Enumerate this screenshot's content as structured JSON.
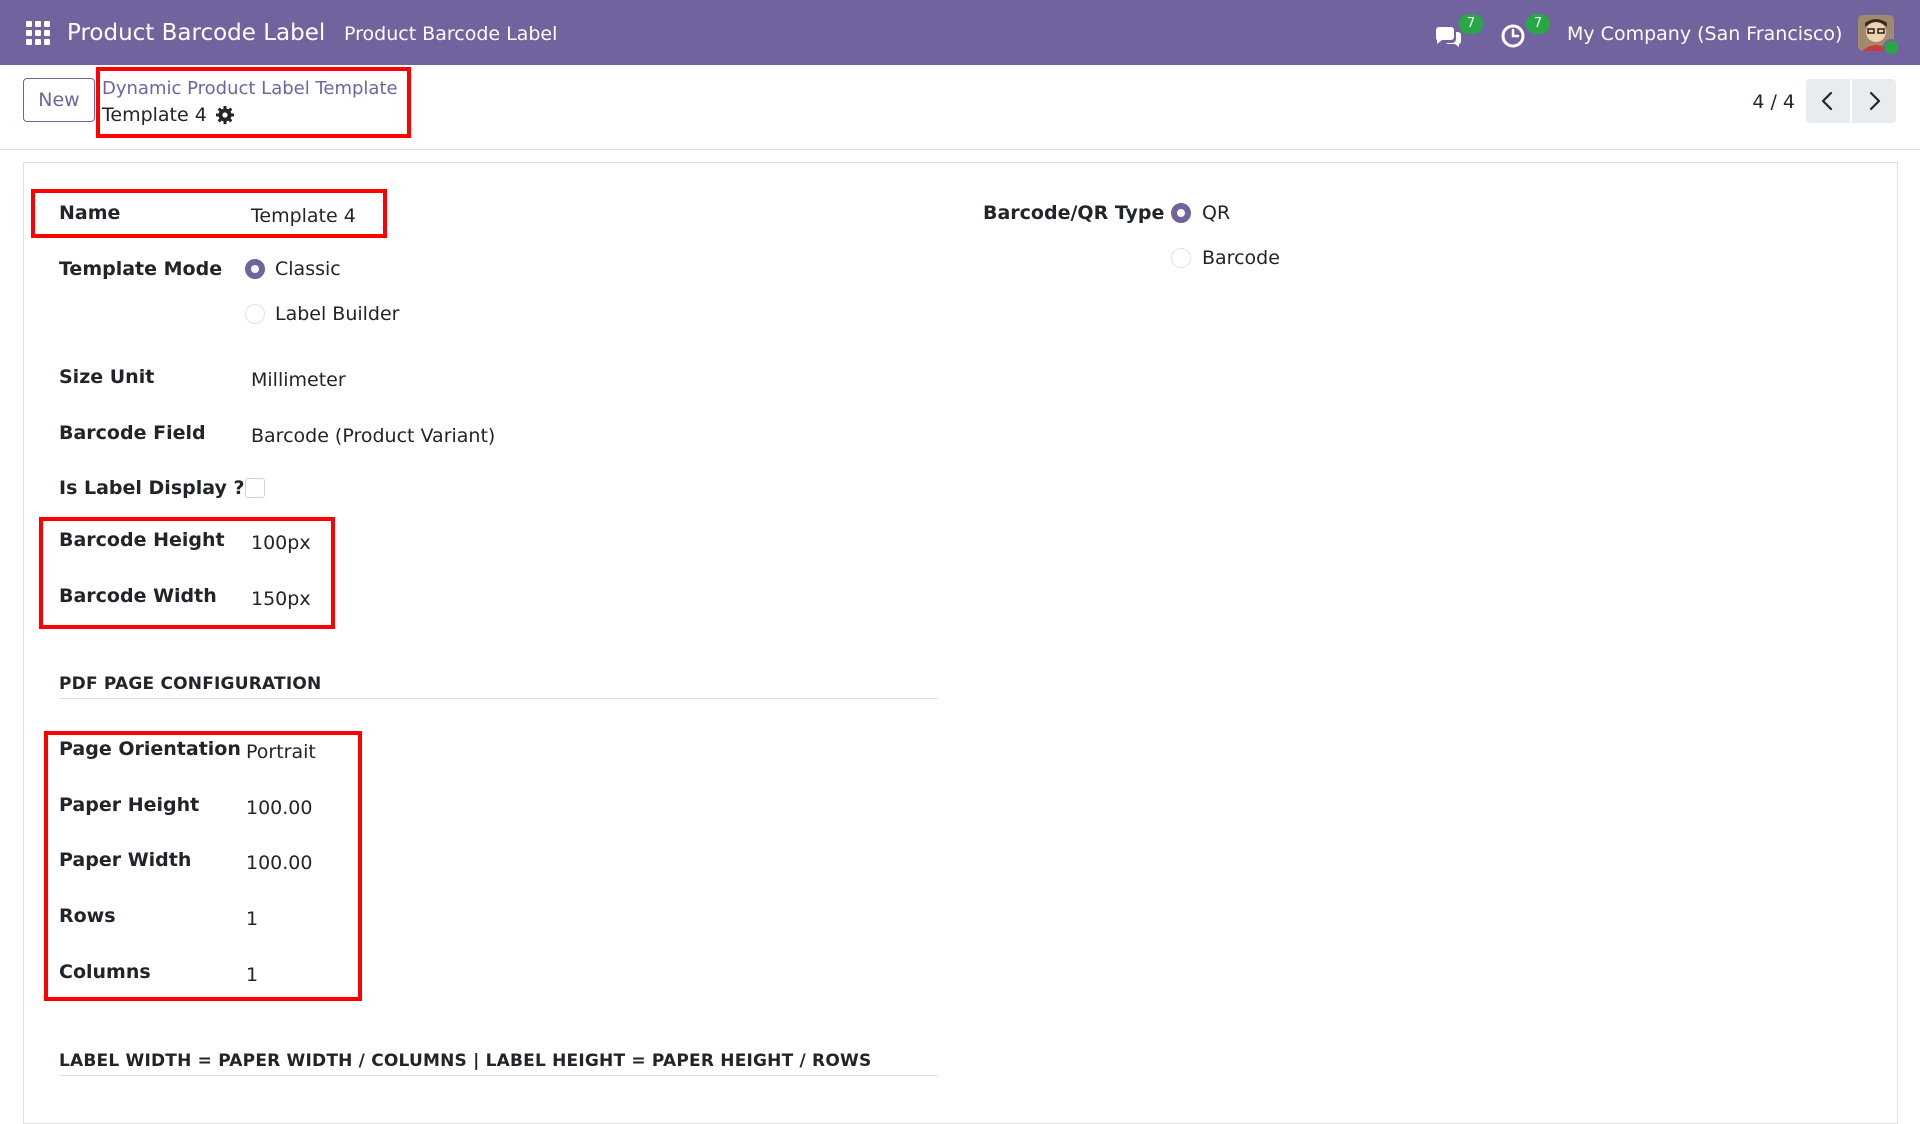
{
  "navbar": {
    "app_title": "Product Barcode Label",
    "menu_item": "Product Barcode Label",
    "chat_count": "7",
    "activity_count": "7",
    "company": "My Company (San Francisco)"
  },
  "control_panel": {
    "new_label": "New",
    "breadcrumb_parent": "Dynamic Product Label Template",
    "breadcrumb_current": "Template 4",
    "pager": "4 / 4"
  },
  "form": {
    "name": {
      "label": "Name",
      "value": "Template 4"
    },
    "template_mode": {
      "label": "Template Mode",
      "options": [
        {
          "label": "Classic",
          "selected": true
        },
        {
          "label": "Label Builder",
          "selected": false
        }
      ]
    },
    "barcode_type": {
      "label": "Barcode/QR Type",
      "options": [
        {
          "label": "QR",
          "selected": true
        },
        {
          "label": "Barcode",
          "selected": false
        }
      ]
    },
    "size_unit": {
      "label": "Size Unit",
      "value": "Millimeter"
    },
    "barcode_field": {
      "label": "Barcode Field",
      "value": "Barcode (Product Variant)"
    },
    "is_label_display": {
      "label": "Is Label Display ?",
      "checked": false
    },
    "barcode_height": {
      "label": "Barcode Height",
      "value": "100px"
    },
    "barcode_width": {
      "label": "Barcode Width",
      "value": "150px"
    },
    "pdf_section_title": "PDF PAGE CONFIGURATION",
    "page_orientation": {
      "label": "Page Orientation",
      "value": "Portrait"
    },
    "paper_height": {
      "label": "Paper Height",
      "value": "100.00"
    },
    "paper_width": {
      "label": "Paper Width",
      "value": "100.00"
    },
    "rows": {
      "label": "Rows",
      "value": "1"
    },
    "columns": {
      "label": "Columns",
      "value": "1"
    },
    "formula_section_title": "LABEL WIDTH = PAPER WIDTH / COLUMNS | LABEL HEIGHT = PAPER HEIGHT / ROWS"
  },
  "colors": {
    "brand": "#71639e",
    "badge": "#28a745",
    "highlight": "#ff0000"
  },
  "icons": [
    "apps-grid-icon",
    "chat-icon",
    "clock-icon",
    "gear-icon",
    "chevron-left-icon",
    "chevron-right-icon"
  ]
}
